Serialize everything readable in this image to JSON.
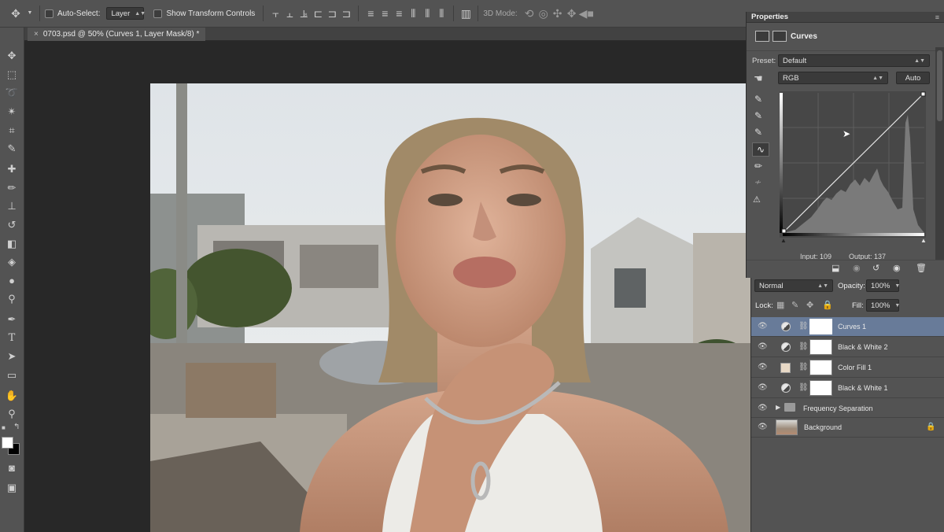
{
  "options_bar": {
    "auto_select_label": "Auto-Select:",
    "auto_select_value": "Layer",
    "show_transform_label": "Show Transform Controls",
    "mode_3d_label": "3D Mode:"
  },
  "document_tab": {
    "title": "0703.psd @ 50% (Curves 1, Layer Mask/8) *"
  },
  "properties": {
    "panel_title": "Properties",
    "adjustment_name": "Curves",
    "preset_label": "Preset:",
    "preset_value": "Default",
    "channel_value": "RGB",
    "auto_label": "Auto",
    "input_label": "Input: 109",
    "output_label": "Output: 137"
  },
  "layers_panel": {
    "blend_mode": "Normal",
    "opacity_label": "Opacity:",
    "opacity_value": "100%",
    "lock_label": "Lock:",
    "fill_label": "Fill:",
    "fill_value": "100%",
    "layers": [
      {
        "name": "Curves 1",
        "selected": true,
        "type": "adjustment"
      },
      {
        "name": "Black & White 2",
        "selected": false,
        "type": "adjustment"
      },
      {
        "name": "Color Fill 1",
        "selected": false,
        "type": "fill"
      },
      {
        "name": "Black & White 1",
        "selected": false,
        "type": "adjustment"
      },
      {
        "name": "Frequency Separation",
        "selected": false,
        "type": "group"
      },
      {
        "name": "Background",
        "selected": false,
        "type": "image"
      }
    ]
  },
  "colors": {
    "panel_bg": "#535353",
    "selected_layer": "#687b99",
    "color_fill_swatch": "#e8d9c6"
  }
}
